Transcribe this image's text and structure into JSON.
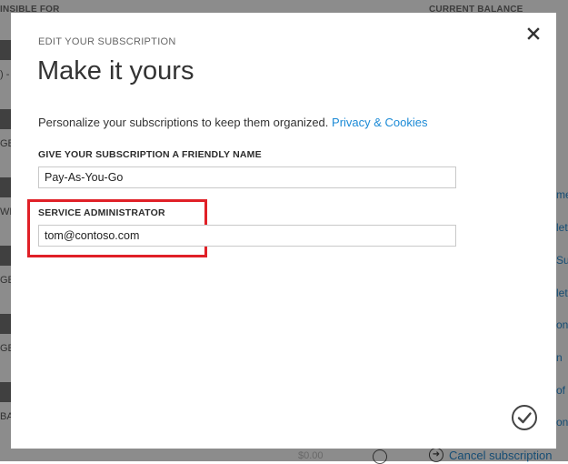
{
  "background": {
    "header_left": "INSIBLE FOR",
    "header_right": "CURRENT BALANCE",
    "row_fragments": [
      ") -",
      "GB)",
      "WF",
      "GE",
      "GE",
      "BAT"
    ],
    "link_fragments": [
      "me",
      "let",
      "Su",
      "let",
      "on",
      "n",
      "of",
      "on"
    ],
    "bottom_amount": "$0.00",
    "cancel_subscription": "Cancel subscription"
  },
  "modal": {
    "eyebrow": "EDIT YOUR SUBSCRIPTION",
    "title": "Make it yours",
    "description": "Personalize your subscriptions to keep them organized.",
    "privacy_link": "Privacy & Cookies",
    "friendly_name": {
      "label": "GIVE YOUR SUBSCRIPTION A FRIENDLY NAME",
      "value": "Pay-As-You-Go"
    },
    "service_admin": {
      "label": "SERVICE ADMINISTRATOR",
      "value": "tom@contoso.com"
    },
    "highlight_color": "#e02027",
    "link_color": "#1b8ad6"
  },
  "icons": {
    "close": "close-icon",
    "confirm": "checkmark-circle-icon",
    "cancel_arrow": "arrow-right-circle-icon"
  }
}
